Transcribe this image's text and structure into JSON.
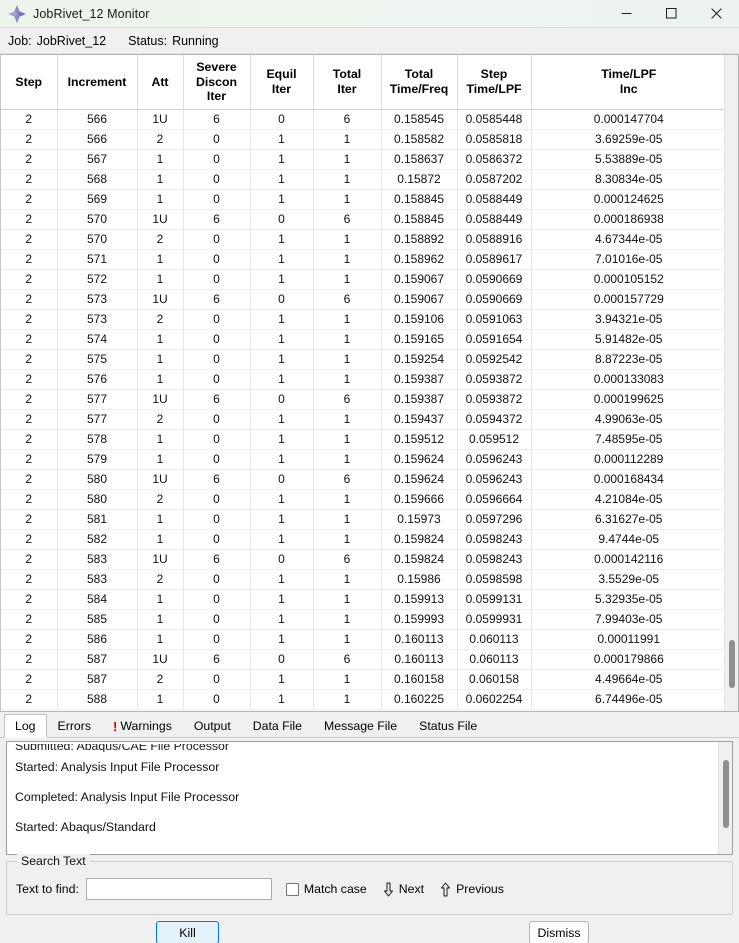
{
  "window": {
    "title": "JobRivet_12 Monitor",
    "icon": "abaqus-diamond-icon",
    "minimize_label": "—",
    "maximize_label": "□",
    "close_label": "✕"
  },
  "job_strip": {
    "job_label": "Job:",
    "job_value": "JobRivet_12",
    "status_label": "Status:",
    "status_value": "Running"
  },
  "table": {
    "columns": [
      "Step",
      "Increment",
      "Att",
      "Severe\nDiscon\nIter",
      "Equil\nIter",
      "Total\nIter",
      "Total\nTime/Freq",
      "Step\nTime/LPF",
      "Time/LPF\nInc"
    ],
    "rows": [
      [
        "2",
        "566",
        "1U",
        "6",
        "0",
        "6",
        "0.158545",
        "0.0585448",
        "0.000147704"
      ],
      [
        "2",
        "566",
        "2",
        "0",
        "1",
        "1",
        "0.158582",
        "0.0585818",
        "3.69259e-05"
      ],
      [
        "2",
        "567",
        "1",
        "0",
        "1",
        "1",
        "0.158637",
        "0.0586372",
        "5.53889e-05"
      ],
      [
        "2",
        "568",
        "1",
        "0",
        "1",
        "1",
        "0.15872",
        "0.0587202",
        "8.30834e-05"
      ],
      [
        "2",
        "569",
        "1",
        "0",
        "1",
        "1",
        "0.158845",
        "0.0588449",
        "0.000124625"
      ],
      [
        "2",
        "570",
        "1U",
        "6",
        "0",
        "6",
        "0.158845",
        "0.0588449",
        "0.000186938"
      ],
      [
        "2",
        "570",
        "2",
        "0",
        "1",
        "1",
        "0.158892",
        "0.0588916",
        "4.67344e-05"
      ],
      [
        "2",
        "571",
        "1",
        "0",
        "1",
        "1",
        "0.158962",
        "0.0589617",
        "7.01016e-05"
      ],
      [
        "2",
        "572",
        "1",
        "0",
        "1",
        "1",
        "0.159067",
        "0.0590669",
        "0.000105152"
      ],
      [
        "2",
        "573",
        "1U",
        "6",
        "0",
        "6",
        "0.159067",
        "0.0590669",
        "0.000157729"
      ],
      [
        "2",
        "573",
        "2",
        "0",
        "1",
        "1",
        "0.159106",
        "0.0591063",
        "3.94321e-05"
      ],
      [
        "2",
        "574",
        "1",
        "0",
        "1",
        "1",
        "0.159165",
        "0.0591654",
        "5.91482e-05"
      ],
      [
        "2",
        "575",
        "1",
        "0",
        "1",
        "1",
        "0.159254",
        "0.0592542",
        "8.87223e-05"
      ],
      [
        "2",
        "576",
        "1",
        "0",
        "1",
        "1",
        "0.159387",
        "0.0593872",
        "0.000133083"
      ],
      [
        "2",
        "577",
        "1U",
        "6",
        "0",
        "6",
        "0.159387",
        "0.0593872",
        "0.000199625"
      ],
      [
        "2",
        "577",
        "2",
        "0",
        "1",
        "1",
        "0.159437",
        "0.0594372",
        "4.99063e-05"
      ],
      [
        "2",
        "578",
        "1",
        "0",
        "1",
        "1",
        "0.159512",
        "0.059512",
        "7.48595e-05"
      ],
      [
        "2",
        "579",
        "1",
        "0",
        "1",
        "1",
        "0.159624",
        "0.0596243",
        "0.000112289"
      ],
      [
        "2",
        "580",
        "1U",
        "6",
        "0",
        "6",
        "0.159624",
        "0.0596243",
        "0.000168434"
      ],
      [
        "2",
        "580",
        "2",
        "0",
        "1",
        "1",
        "0.159666",
        "0.0596664",
        "4.21084e-05"
      ],
      [
        "2",
        "581",
        "1",
        "0",
        "1",
        "1",
        "0.15973",
        "0.0597296",
        "6.31627e-05"
      ],
      [
        "2",
        "582",
        "1",
        "0",
        "1",
        "1",
        "0.159824",
        "0.0598243",
        "9.4744e-05"
      ],
      [
        "2",
        "583",
        "1U",
        "6",
        "0",
        "6",
        "0.159824",
        "0.0598243",
        "0.000142116"
      ],
      [
        "2",
        "583",
        "2",
        "0",
        "1",
        "1",
        "0.15986",
        "0.0598598",
        "3.5529e-05"
      ],
      [
        "2",
        "584",
        "1",
        "0",
        "1",
        "1",
        "0.159913",
        "0.0599131",
        "5.32935e-05"
      ],
      [
        "2",
        "585",
        "1",
        "0",
        "1",
        "1",
        "0.159993",
        "0.0599931",
        "7.99403e-05"
      ],
      [
        "2",
        "586",
        "1",
        "0",
        "1",
        "1",
        "0.160113",
        "0.060113",
        "0.00011991"
      ],
      [
        "2",
        "587",
        "1U",
        "6",
        "0",
        "6",
        "0.160113",
        "0.060113",
        "0.000179866"
      ],
      [
        "2",
        "587",
        "2",
        "0",
        "1",
        "1",
        "0.160158",
        "0.060158",
        "4.49664e-05"
      ],
      [
        "2",
        "588",
        "1",
        "0",
        "1",
        "1",
        "0.160225",
        "0.0602254",
        "6.74496e-05"
      ]
    ]
  },
  "tabs": {
    "items": [
      {
        "label": "Log",
        "active": true,
        "warn": false
      },
      {
        "label": "Errors",
        "active": false,
        "warn": false
      },
      {
        "label": "Warnings",
        "active": false,
        "warn": true
      },
      {
        "label": "Output",
        "active": false,
        "warn": false
      },
      {
        "label": "Data File",
        "active": false,
        "warn": false
      },
      {
        "label": "Message File",
        "active": false,
        "warn": false
      },
      {
        "label": "Status File",
        "active": false,
        "warn": false
      }
    ],
    "warn_marker": "!"
  },
  "log": {
    "lines": [
      "Submitted: Abaqus/CAE File Processor",
      "Started:  Analysis Input File Processor",
      "Completed: Analysis Input File Processor",
      "Started:  Abaqus/Standard"
    ]
  },
  "search": {
    "legend": "Search Text",
    "find_label": "Text to find:",
    "find_value": "",
    "find_placeholder": "",
    "match_case_label": "Match case",
    "next_label": "Next",
    "previous_label": "Previous",
    "next_icon": "arrow-down-icon",
    "previous_icon": "arrow-up-icon"
  },
  "buttons": {
    "kill_label": "Kill",
    "dismiss_label": "Dismiss"
  },
  "colors": {
    "titlebar_tint": "#edf4ec",
    "accent": "#0078d4",
    "warning": "#d00000",
    "kill_fill": "#e3f1fb"
  }
}
